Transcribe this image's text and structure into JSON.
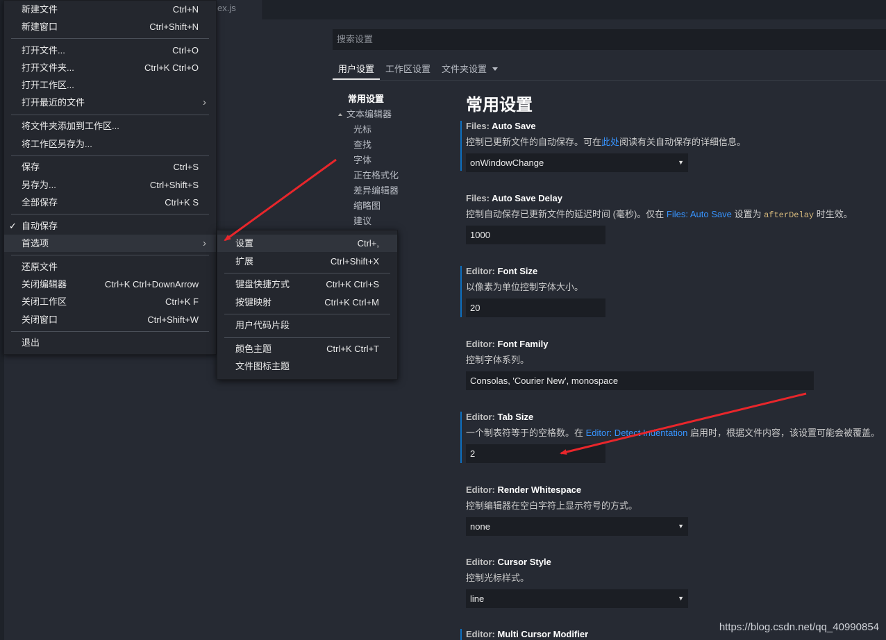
{
  "editor_tab": {
    "label": "ex.js"
  },
  "search": {
    "placeholder": "搜索设置"
  },
  "scope_tabs": [
    {
      "label": "用户设置",
      "active": true
    },
    {
      "label": "工作区设置",
      "active": false
    },
    {
      "label": "文件夹设置",
      "active": false
    }
  ],
  "toc": {
    "items": [
      "常用设置",
      "文本编辑器",
      "光标",
      "查找",
      "字体",
      "正在格式化",
      "差异编辑器",
      "缩略图",
      "建议"
    ]
  },
  "section_title": "常用设置",
  "settings": [
    {
      "category": "Files: ",
      "name": "Auto Save",
      "desc_a": "控制已更新文件的自动保存。可在",
      "desc_link": "此处",
      "desc_b": "阅读有关自动保存的详细信息。",
      "value": "onWindowChange",
      "control": "dropdown",
      "modified": true
    },
    {
      "category": "Files: ",
      "name": "Auto Save Delay",
      "desc_a": "控制自动保存已更新文件的延迟时间 (毫秒)。仅在 ",
      "desc_link": "Files: Auto Save",
      "desc_b": " 设置为 ",
      "desc_code": "afterDelay",
      "desc_c": " 时生效。",
      "value": "1000",
      "control": "text",
      "modified": false
    },
    {
      "category": "Editor: ",
      "name": "Font Size",
      "desc_a": "以像素为单位控制字体大小。",
      "value": "20",
      "control": "text",
      "modified": true
    },
    {
      "category": "Editor: ",
      "name": "Font Family",
      "desc_a": "控制字体系列。",
      "value": "Consolas, 'Courier New', monospace",
      "control": "text",
      "modified": false
    },
    {
      "category": "Editor: ",
      "name": "Tab Size",
      "desc_a": "一个制表符等于的空格数。在 ",
      "desc_link": "Editor: Detect Indentation",
      "desc_b": " 启用时，根据文件内容，该设置可能会被覆盖。",
      "value": "2",
      "control": "text",
      "modified": true
    },
    {
      "category": "Editor: ",
      "name": "Render Whitespace",
      "desc_a": "控制编辑器在空白字符上显示符号的方式。",
      "value": "none",
      "control": "dropdown",
      "modified": false
    },
    {
      "category": "Editor: ",
      "name": "Cursor Style",
      "desc_a": "控制光标样式。",
      "value": "line",
      "control": "dropdown",
      "modified": false
    },
    {
      "category": "Editor: ",
      "name": "Multi Cursor Modifier",
      "modified": true
    }
  ],
  "file_menu": {
    "items": [
      {
        "label": "新建文件",
        "key": "Ctrl+N"
      },
      {
        "label": "新建窗口",
        "key": "Ctrl+Shift+N"
      },
      {
        "label": "打开文件...",
        "key": "Ctrl+O"
      },
      {
        "label": "打开文件夹...",
        "key": "Ctrl+K Ctrl+O"
      },
      {
        "label": "打开工作区...",
        "key": ""
      },
      {
        "label": "打开最近的文件",
        "key": ""
      },
      {
        "label": "将文件夹添加到工作区...",
        "key": ""
      },
      {
        "label": "将工作区另存为...",
        "key": ""
      },
      {
        "label": "保存",
        "key": "Ctrl+S"
      },
      {
        "label": "另存为...",
        "key": "Ctrl+Shift+S"
      },
      {
        "label": "全部保存",
        "key": "Ctrl+K S"
      },
      {
        "label": "自动保存",
        "key": "",
        "checked": true
      },
      {
        "label": "首选项",
        "key": ""
      },
      {
        "label": "还原文件",
        "key": ""
      },
      {
        "label": "关闭编辑器",
        "key": "Ctrl+K Ctrl+DownArrow"
      },
      {
        "label": "关闭工作区",
        "key": "Ctrl+K F"
      },
      {
        "label": "关闭窗口",
        "key": "Ctrl+Shift+W"
      },
      {
        "label": "退出",
        "key": ""
      }
    ]
  },
  "preferences_menu": {
    "items": [
      {
        "label": "设置",
        "key": "Ctrl+,"
      },
      {
        "label": "扩展",
        "key": "Ctrl+Shift+X"
      },
      {
        "label": "键盘快捷方式",
        "key": "Ctrl+K Ctrl+S"
      },
      {
        "label": "按键映射",
        "key": "Ctrl+K Ctrl+M"
      },
      {
        "label": "用户代码片段",
        "key": ""
      },
      {
        "label": "颜色主题",
        "key": "Ctrl+K Ctrl+T"
      },
      {
        "label": "文件图标主题",
        "key": ""
      }
    ]
  },
  "icons": {
    "check": "checkmark-icon",
    "chevron": "chevron-right-icon",
    "dropdown": "chevron-down-icon",
    "arrow": "red-arrow-annotation"
  },
  "colors": {
    "background": "#262a33",
    "menu": "#24272e",
    "link": "#3794ff",
    "modified_bar": "#0e70c0",
    "annotation": "#e8262b"
  },
  "watermark": "https://blog.csdn.net/qq_40990854"
}
